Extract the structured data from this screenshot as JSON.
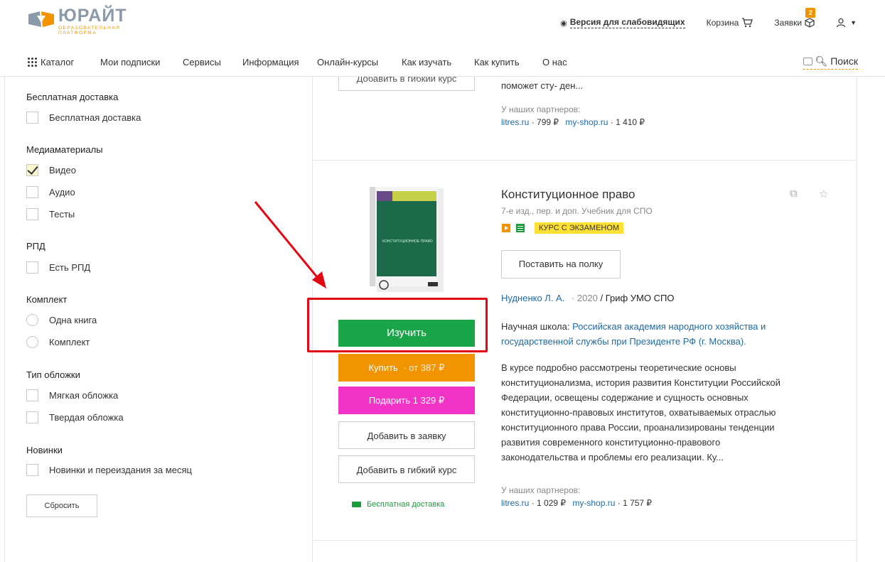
{
  "brand": {
    "name": "ЮРАЙТ",
    "subtitle": "ОБРАЗОВАТЕЛЬНАЯ ПЛАТФОРМА"
  },
  "header": {
    "vision_label": "Версия для слабовидящих",
    "cart_label": "Корзина",
    "requests_label": "Заявки",
    "requests_count": "2"
  },
  "nav": {
    "items": [
      "Каталог",
      "Мои подписки",
      "Сервисы",
      "Информация",
      "Онлайн-курсы",
      "Как изучать",
      "Как купить",
      "О нас"
    ],
    "search_label": "Поиск"
  },
  "filters": {
    "free_delivery": {
      "title": "Бесплатная доставка",
      "options": [
        "Бесплатная доставка"
      ]
    },
    "media": {
      "title": "Медиаматериалы",
      "options": [
        "Видео",
        "Аудио",
        "Тесты"
      ],
      "checked": "Видео"
    },
    "rpd": {
      "title": "РПД",
      "options": [
        "Есть РПД"
      ]
    },
    "kit": {
      "title": "Комплект",
      "options": [
        "Одна книга",
        "Комплект"
      ]
    },
    "cover": {
      "title": "Тип обложки",
      "options": [
        "Мягкая обложка",
        "Твердая обложка"
      ]
    },
    "news": {
      "title": "Новинки",
      "options": [
        "Новинки и переиздания за месяц"
      ]
    },
    "reset_label": "Сбросить"
  },
  "prev_item": {
    "button_partial": "Добавить в гибкий курс",
    "desc_tail": "поможет сту- ден...",
    "partners_title": "У наших партнеров:",
    "partner1": "litres.ru",
    "partner1_price": "· 799 ₽",
    "partner2": "my-shop.ru",
    "partner2_price": "· 1 410 ₽"
  },
  "book": {
    "title": "Конституционное право",
    "subtitle": "7-е изд., пер. и доп. Учебник для СПО",
    "exam_badge": "КУРС С ЭКЗАМЕНОМ",
    "shelf_label": "Поставить на полку",
    "author": "Нудненко Л. А.",
    "year": "· 2020",
    "grif": "/ Гриф УМО СПО",
    "school_label": "Научная школа:",
    "school_line1": "Российская академия народного хозяйства и",
    "school_line2": "государственной службы при Президенте РФ (г. Москва).",
    "desc_lines": [
      "В курсе подробно рассмотрены теоретические основы",
      "конституционализма, история развития Конституции Российской",
      "Федерации, освещены содержание и сущность основных",
      "конституционно-правовых институтов, охватываемых отраслью",
      "конституционного права России, проанализированы тенденции",
      "развития современного конституционно-правового",
      "законодательства и проблемы его реализации. Ку..."
    ],
    "partners_title": "У наших партнеров:",
    "partner1": "litres.ru",
    "partner1_price": "· 1 029 ₽",
    "partner2": "my-shop.ru",
    "partner2_price": "· 1 757 ₽",
    "cover_title": "КОНСТИТУЦИОННОЕ ПРАВО",
    "buttons": {
      "study": "Изучить",
      "buy": "Купить",
      "buy_price": "· от 387 ₽",
      "gift": "Подарить 1 329 ₽",
      "request": "Добавить в заявку",
      "flex": "Добавить в гибкий курс"
    },
    "free_delivery": "Бесплатная доставка"
  },
  "colors": {
    "study": "#1aa549",
    "buy": "#f29400",
    "gift": "#f233c8",
    "exam_badge": "#ffe033",
    "annotation": "#e30613"
  }
}
